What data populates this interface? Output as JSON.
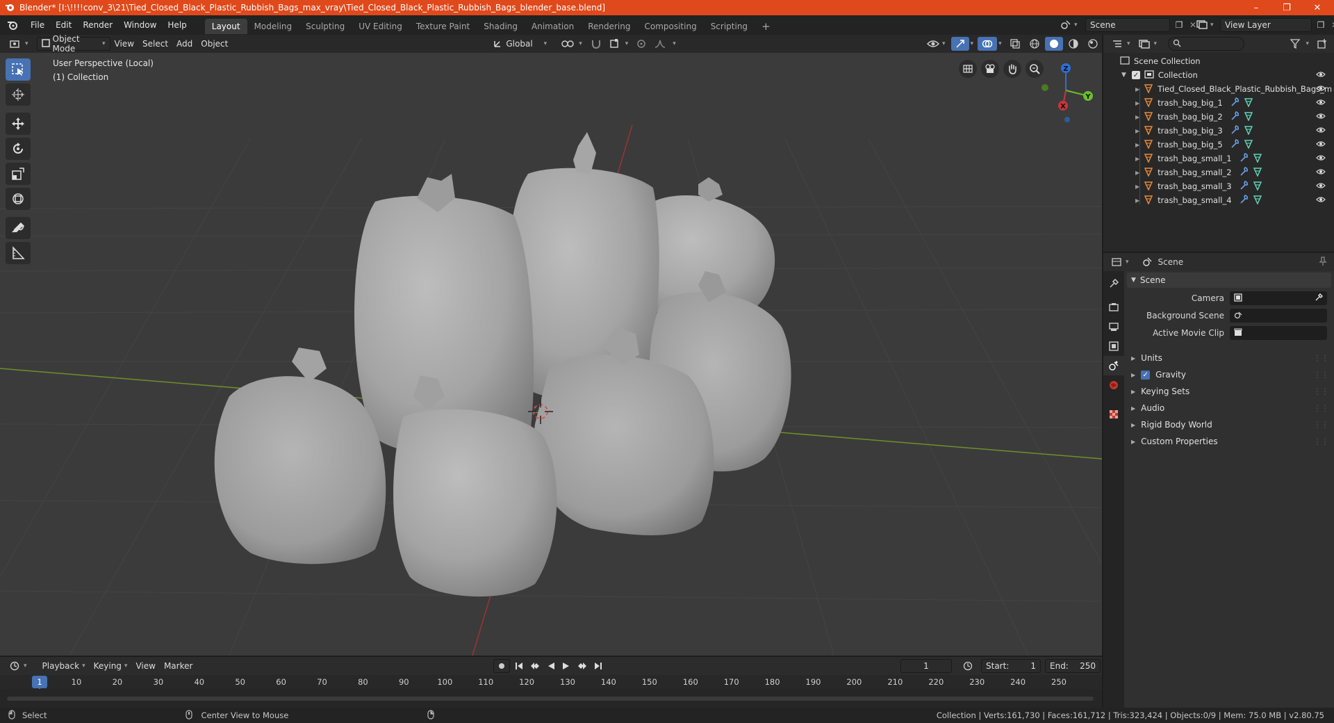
{
  "window": {
    "title": "Blender* [I:\\!!!!conv_3\\21\\Tied_Closed_Black_Plastic_Rubbish_Bags_max_vray\\Tied_Closed_Black_Plastic_Rubbish_Bags_blender_base.blend]",
    "minimize": "–",
    "maximize": "❐",
    "close": "✕"
  },
  "menus": [
    "File",
    "Edit",
    "Render",
    "Window",
    "Help"
  ],
  "workspaces": [
    "Layout",
    "Modeling",
    "Sculpting",
    "UV Editing",
    "Texture Paint",
    "Shading",
    "Animation",
    "Rendering",
    "Compositing",
    "Scripting"
  ],
  "active_workspace": "Layout",
  "add_workspace": "+",
  "scene_field": "Scene",
  "view_layer_field": "View Layer",
  "viewport": {
    "mode": "Object Mode",
    "menus": [
      "View",
      "Select",
      "Add",
      "Object"
    ],
    "transform_orientation": "Global",
    "overlay_line1": "User Perspective (Local)",
    "overlay_line2": "(1) Collection",
    "gizmo": {
      "x": "X",
      "y": "Y",
      "z": "Z"
    }
  },
  "outliner": {
    "search_placeholder": "",
    "root": "Scene Collection",
    "collection": "Collection",
    "items": [
      "Tied_Closed_Black_Plastic_Rubbish_Bags_m",
      "trash_bag_big_1",
      "trash_bag_big_2",
      "trash_bag_big_3",
      "trash_bag_big_5",
      "trash_bag_small_1",
      "trash_bag_small_2",
      "trash_bag_small_3",
      "trash_bag_small_4"
    ]
  },
  "properties": {
    "header": "Scene",
    "section": "Scene",
    "fields": {
      "camera": "Camera",
      "background_scene": "Background Scene",
      "active_movie_clip": "Active Movie Clip"
    },
    "subsections": [
      "Units",
      "Gravity",
      "Keying Sets",
      "Audio",
      "Rigid Body World",
      "Custom Properties"
    ],
    "gravity_checked": true
  },
  "timeline": {
    "menus": [
      "Playback",
      "Keying",
      "View",
      "Marker"
    ],
    "current_frame": "1",
    "start_label": "Start:",
    "start": "1",
    "end_label": "End:",
    "end": "250",
    "ticks": [
      "1",
      "10",
      "20",
      "30",
      "40",
      "50",
      "60",
      "70",
      "80",
      "90",
      "100",
      "110",
      "120",
      "130",
      "140",
      "150",
      "160",
      "170",
      "180",
      "190",
      "200",
      "210",
      "220",
      "230",
      "240",
      "250"
    ]
  },
  "statusbar": {
    "left_action": "Select",
    "middle_action": "Center View to Mouse",
    "stats": "Collection | Verts:161,730 | Faces:161,712 | Tris:323,424 | Objects:0/9 | Mem: 75.0 MB | v2.80.75"
  },
  "colors": {
    "titlebar": "#e0491b",
    "accent": "#4772b3",
    "mesh_icon": "#e8893a",
    "data_icon": "#5fd1b5"
  }
}
